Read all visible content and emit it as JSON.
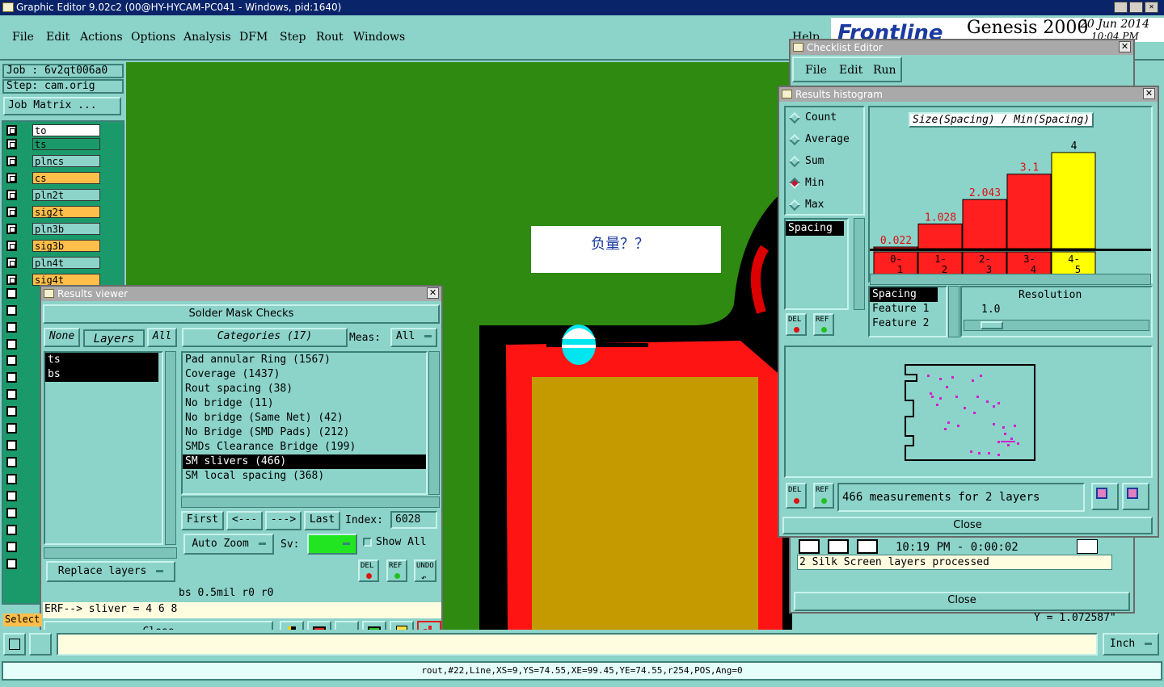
{
  "app": {
    "title": "Graphic Editor 9.02c2 (00@HY-HYCAM-PC041 - Windows, pid:1640)",
    "brand": "Frontline",
    "product": "Genesis 2000",
    "date": "20 Jun 2014",
    "time": "10:04 PM",
    "help": "Help"
  },
  "menu": [
    "File",
    "Edit",
    "Actions",
    "Options",
    "Analysis",
    "DFM",
    "Step",
    "Rout",
    "Windows"
  ],
  "job": {
    "job_line": "Job : 6v2qt006a0",
    "step_line": "Step: cam.orig",
    "matrix_button": "Job Matrix ..."
  },
  "layers": [
    {
      "name": "to",
      "color": "#ffffff"
    },
    {
      "name": "ts",
      "color": "#1a9a6a"
    },
    {
      "name": "plncs",
      "color": "#8cd3c9"
    },
    {
      "name": "cs",
      "color": "#ffbf4a"
    },
    {
      "name": "pln2t",
      "color": "#8cd3c9"
    },
    {
      "name": "sig2t",
      "color": "#ffbf4a"
    },
    {
      "name": "pln3b",
      "color": "#8cd3c9"
    },
    {
      "name": "sig3b",
      "color": "#ffbf4a"
    },
    {
      "name": "pln4t",
      "color": "#8cd3c9"
    },
    {
      "name": "sig4t",
      "color": "#ffbf4a"
    }
  ],
  "canvas": {
    "popup_text": "负量？？"
  },
  "results_viewer": {
    "title": "Results viewer",
    "header": "Solder Mask Checks",
    "none_btn": "None",
    "layers_label": "Layers",
    "all_btn": "All",
    "categories_label": "Categories (17)",
    "meas_label": "Meas:",
    "meas_value": "All",
    "layer_list": [
      "ts",
      "bs"
    ],
    "categories": [
      "Pad annular Ring (1567)",
      "Coverage (1437)",
      "Rout spacing (38)",
      "No bridge (11)",
      "No bridge (Same Net) (42)",
      "No Bridge (SMD Pads) (212)",
      "SMDs Clearance Bridge (199)",
      "SM slivers (466)",
      "SM local spacing (368)"
    ],
    "selected_category": "SM slivers (466)",
    "first": "First",
    "prev": "<---",
    "next": "--->",
    "last": "Last",
    "index_label": "Index:",
    "index_value": "6028",
    "auto_zoom": "Auto Zoom",
    "sv_label": "Sv:",
    "show_all": "Show All",
    "replace_layers": "Replace layers",
    "status": "bs 0.5mil  r0  r0",
    "erf": "ERF--> sliver = 4 6 8",
    "close": "Close",
    "del": "DEL",
    "ref": "REF",
    "undo": "UNDO"
  },
  "checklist": {
    "title": "Checklist Editor",
    "menu": [
      "File",
      "Edit",
      "Run"
    ],
    "time_line": "10:19 PM - 0:00:02",
    "log_line": "2 Silk Screen layers processed",
    "close": "Close"
  },
  "histogram": {
    "title": "Results histogram",
    "modes": [
      "Count",
      "Average",
      "Sum",
      "Min",
      "Max"
    ],
    "selected_mode": "Min",
    "side_list": [
      "Spacing"
    ],
    "chart_title": "Size(Spacing) / Min(Spacing)",
    "resolution_label": "Resolution",
    "resolution_value": "1.0",
    "attr_list": [
      "Spacing",
      "Feature 1",
      "Feature 2"
    ],
    "summary": "466 measurements for 2 layers",
    "close": "Close",
    "del": "DEL",
    "ref": "REF"
  },
  "chart_data": {
    "type": "bar",
    "title": "Size(Spacing) / Min(Spacing)",
    "categories": [
      "0-1",
      "1-2",
      "2-3",
      "3-4",
      "4-5"
    ],
    "values": [
      0.022,
      1.028,
      2.043,
      3.1,
      4
    ],
    "labels": [
      "0.022",
      "1.028",
      "2.043",
      "3.1",
      "4"
    ],
    "selected_index": 4,
    "bar_color": "#ff1f1f",
    "selected_color": "#ffff00",
    "ylim": [
      0,
      4.2
    ]
  },
  "bottom": {
    "select_label": "Select",
    "y_readout": "Y = 1.072587\"",
    "unit": "Inch",
    "status_bar": "rout,#22,Line,XS=9,YS=74.55,XE=99.45,YE=74.55,r254,POS,Ang=0"
  }
}
